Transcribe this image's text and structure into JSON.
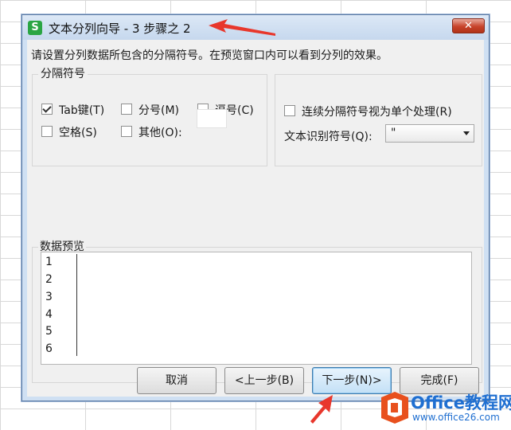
{
  "window": {
    "app_icon_letter": "S",
    "title": "文本分列向导 - 3 步骤之 2",
    "close_glyph": "✕"
  },
  "instruction": "请设置分列数据所包含的分隔符号。在预览窗口内可以看到分列的效果。",
  "delimiters": {
    "caption": "分隔符号",
    "options": [
      {
        "label": "Tab键(T)",
        "checked": true
      },
      {
        "label": "分号(M)",
        "checked": false
      },
      {
        "label": "逗号(C)",
        "checked": false
      },
      {
        "label": "空格(S)",
        "checked": false
      },
      {
        "label": "其他(O):",
        "checked": false
      }
    ],
    "other_value": ""
  },
  "consecutive": {
    "label": "连续分隔符号视为单个处理(R)",
    "checked": false
  },
  "text_qualifier": {
    "label": "文本识别符号(Q):",
    "value": "\""
  },
  "preview": {
    "caption": "数据预览",
    "rows": [
      "1",
      "2",
      "3",
      "4",
      "5",
      "6"
    ]
  },
  "buttons": {
    "cancel": "取消",
    "back": "<上一步(B)",
    "next": "下一步(N)>",
    "finish": "完成(F)"
  },
  "watermark": {
    "text": "Office教程网",
    "url": "www.office26.com"
  },
  "colors": {
    "annotation_red": "#e8372c",
    "dialog_border": "#5d7ca5",
    "primary_button": "#c3e0f6"
  }
}
